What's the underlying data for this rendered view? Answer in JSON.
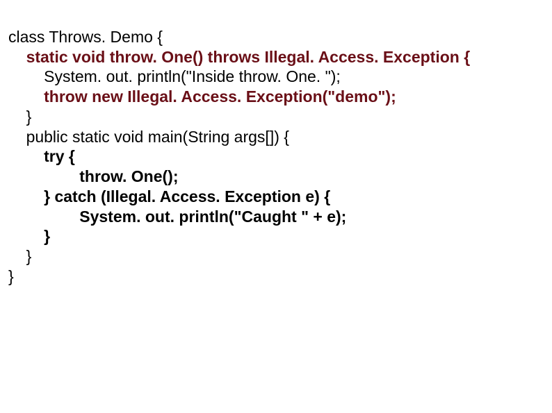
{
  "lines": {
    "l1": "class Throws. Demo {",
    "l2": "static void throw. One() throws Illegal. Access. Exception {",
    "l3": "System. out. println(\"Inside throw. One. \");",
    "l4": "throw new Illegal. Access. Exception(\"demo\");",
    "l5": "}",
    "l6": "public static void main(String args[]) {",
    "l7": "try {",
    "l8": "throw. One();",
    "l9": "} catch (Illegal. Access. Exception e) {",
    "l10": "System. out. println(\"Caught \" + e);",
    "l11": "}",
    "l12": "}",
    "l13": "}"
  }
}
